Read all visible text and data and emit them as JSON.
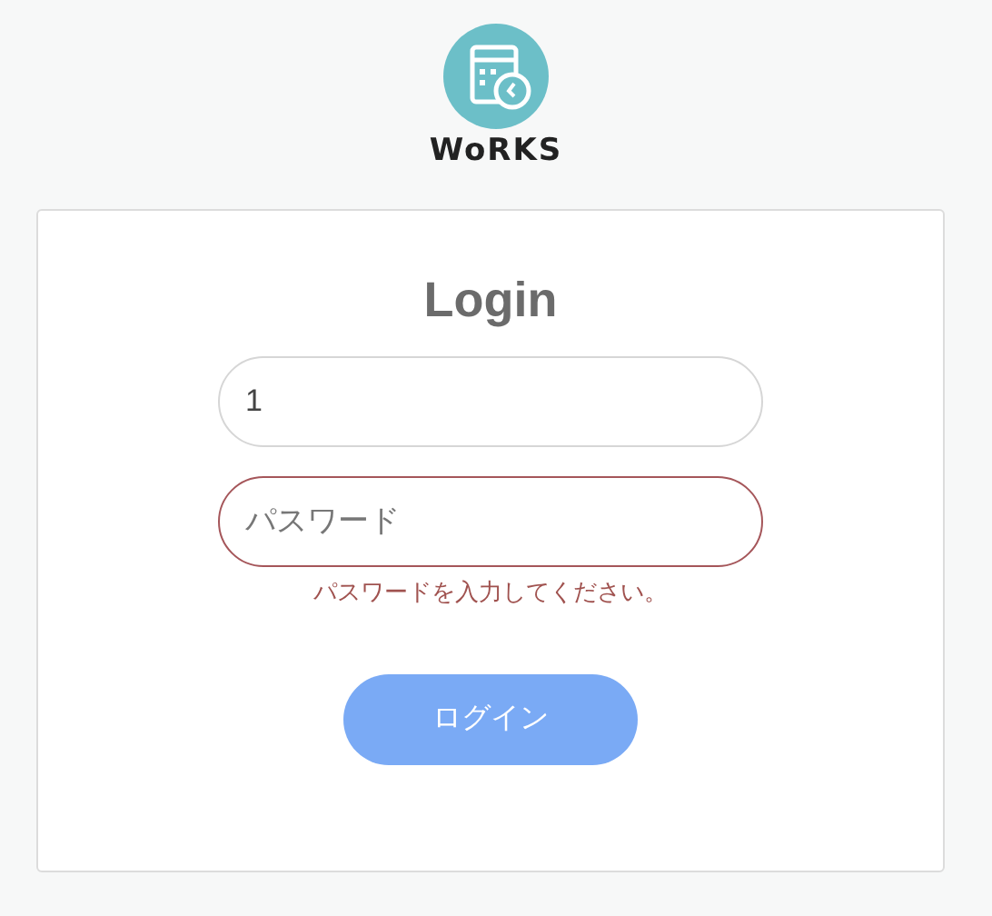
{
  "logo": {
    "text": "WoRKS"
  },
  "login": {
    "title": "Login",
    "fields": [
      {
        "kind": "text",
        "value": "1",
        "invalid": false
      },
      {
        "kind": "password",
        "placeholder": "パスワード",
        "invalid": true,
        "error": "パスワードを入力してください。"
      }
    ],
    "button": "ログイン"
  }
}
